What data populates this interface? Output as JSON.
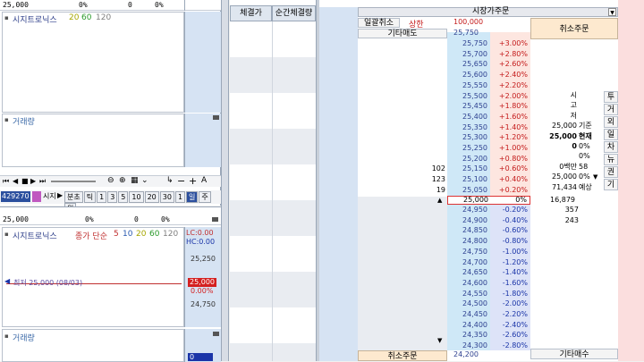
{
  "top_chart": {
    "row_values": [
      "25,000",
      "0%",
      "0",
      "0%"
    ],
    "title": "시지트로닉스",
    "ma": [
      {
        "label": "20",
        "color": "#a6a600"
      },
      {
        "label": "60",
        "color": "#2a9a2a"
      },
      {
        "label": "120",
        "color": "#7f7f7f"
      }
    ],
    "volume_label": "거래량",
    "toolbar_code": "429270",
    "toolbar_name": "시지",
    "toolbar_items": [
      "분초",
      "틱",
      "1",
      "3",
      "5",
      "10",
      "20",
      "30",
      "1",
      "일",
      "주",
      "월"
    ]
  },
  "bottom_chart": {
    "row_values": [
      "25,000",
      "0%",
      "0",
      "0%"
    ],
    "title": "시지트로닉스",
    "subtitle": "종가 단순",
    "ma": [
      {
        "label": "5",
        "color": "#c03030"
      },
      {
        "label": "10",
        "color": "#2a5ab0"
      },
      {
        "label": "20",
        "color": "#a6a600"
      },
      {
        "label": "60",
        "color": "#2a9a2a"
      },
      {
        "label": "120",
        "color": "#7f7f7f"
      }
    ],
    "lc": "LC:0.00",
    "hc": "HC:0.00",
    "axis": [
      "25,250",
      "24,750"
    ],
    "current_price": "25,000",
    "current_pct": "0.00%",
    "annotation": "최저 25,000 (08/03)",
    "volume_label": "거래량",
    "bottom_value": "0"
  },
  "middle": {
    "headers": [
      "체결가",
      "순간체결량"
    ]
  },
  "orderbook": {
    "top_title": "시장가주문",
    "btn_cancel_all": "일괄취소",
    "upper_limit_label": "상한",
    "upper_limit_value": "100,000",
    "extra_price": "25,750",
    "btn_other_sell": "기타매도",
    "btn_cancel_order": "취소주문",
    "btn_cancel_order_bottom": "취소주문",
    "btn_other_buy": "기타매수",
    "bottom_price": "24,200",
    "asks": [
      {
        "price": "25,750",
        "pct": "+3.00%",
        "qty": ""
      },
      {
        "price": "25,700",
        "pct": "+2.80%",
        "qty": ""
      },
      {
        "price": "25,650",
        "pct": "+2.60%",
        "qty": ""
      },
      {
        "price": "25,600",
        "pct": "+2.40%",
        "qty": ""
      },
      {
        "price": "25,550",
        "pct": "+2.20%",
        "qty": ""
      },
      {
        "price": "25,500",
        "pct": "+2.00%",
        "qty": ""
      },
      {
        "price": "25,450",
        "pct": "+1.80%",
        "qty": ""
      },
      {
        "price": "25,400",
        "pct": "+1.60%",
        "qty": ""
      },
      {
        "price": "25,350",
        "pct": "+1.40%",
        "qty": ""
      },
      {
        "price": "25,300",
        "pct": "+1.20%",
        "qty": ""
      },
      {
        "price": "25,250",
        "pct": "+1.00%",
        "qty": ""
      },
      {
        "price": "25,200",
        "pct": "+0.80%",
        "qty": ""
      },
      {
        "price": "25,150",
        "pct": "+0.60%",
        "qty": "102"
      },
      {
        "price": "25,100",
        "pct": "+0.40%",
        "qty": "123"
      },
      {
        "price": "25,050",
        "pct": "+0.20%",
        "qty": "19"
      }
    ],
    "current": {
      "price": "25,000",
      "pct": "0%"
    },
    "bids": [
      {
        "price": "24,950",
        "pct": "-0.20%",
        "qty": "357"
      },
      {
        "price": "24,900",
        "pct": "-0.40%",
        "qty": "243"
      },
      {
        "price": "24,850",
        "pct": "-0.60%",
        "qty": ""
      },
      {
        "price": "24,800",
        "pct": "-0.80%",
        "qty": ""
      },
      {
        "price": "24,750",
        "pct": "-1.00%",
        "qty": ""
      },
      {
        "price": "24,700",
        "pct": "-1.20%",
        "qty": ""
      },
      {
        "price": "24,650",
        "pct": "-1.40%",
        "qty": ""
      },
      {
        "price": "24,600",
        "pct": "-1.60%",
        "qty": ""
      },
      {
        "price": "24,550",
        "pct": "-1.80%",
        "qty": ""
      },
      {
        "price": "24,500",
        "pct": "-2.00%",
        "qty": ""
      },
      {
        "price": "24,450",
        "pct": "-2.20%",
        "qty": ""
      },
      {
        "price": "24,400",
        "pct": "-2.40%",
        "qty": ""
      },
      {
        "price": "24,350",
        "pct": "-2.60%",
        "qty": ""
      },
      {
        "price": "24,300",
        "pct": "-2.80%",
        "qty": ""
      }
    ],
    "current_bid_qty": "16,879",
    "info_rows": [
      {
        "k": "시",
        "v": ""
      },
      {
        "k": "고",
        "v": ""
      },
      {
        "k": "저",
        "v": ""
      },
      {
        "k": "25,000",
        "v": "기준"
      },
      {
        "k": "25,000",
        "v": "현재"
      },
      {
        "k": "0",
        "v": "0%"
      },
      {
        "k": "",
        "v": "0%"
      },
      {
        "k": "0백만",
        "v": "58"
      },
      {
        "k": "25,000",
        "v": "0%"
      },
      {
        "k": "71,434",
        "v": "예상"
      }
    ],
    "side_tabs": [
      "투",
      "거",
      "외",
      "일",
      "차",
      "뉴",
      "권",
      "기"
    ]
  }
}
